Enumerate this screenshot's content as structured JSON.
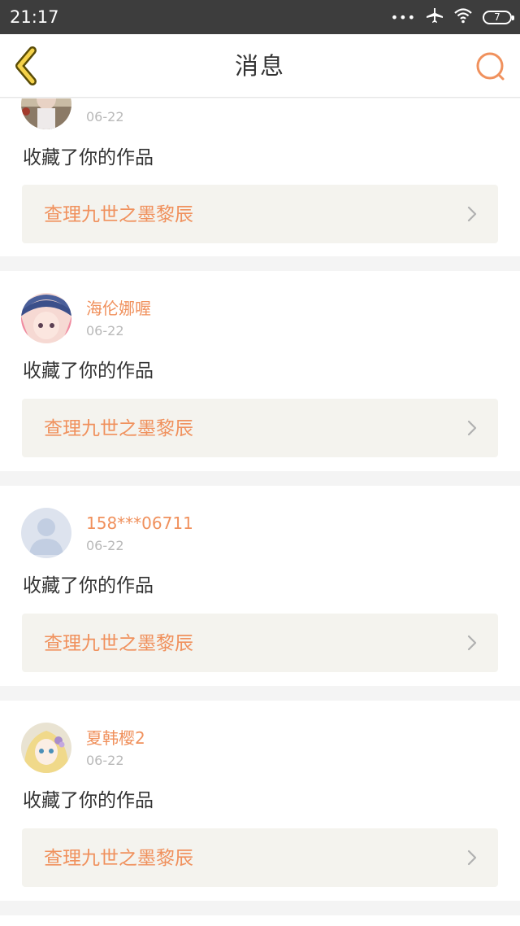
{
  "status_bar": {
    "time": "21:17",
    "dots": "•••",
    "battery": "7"
  },
  "header": {
    "title": "消息"
  },
  "colors": {
    "accent": "#f0915d",
    "back_arrow": "#7a6a08",
    "back_arrow_fill": "#f5d24a",
    "status_bar_bg": "#3d3d3d"
  },
  "icons": {
    "back": "back-arrow-icon",
    "search": "search-icon",
    "chevron": "chevron-right-icon"
  },
  "notifications": [
    {
      "username": "",
      "date": "06-22",
      "action": "收藏了你的作品",
      "work_title": "查理九世之墨黎辰"
    },
    {
      "username": "海伦娜喔",
      "date": "06-22",
      "action": "收藏了你的作品",
      "work_title": "查理九世之墨黎辰"
    },
    {
      "username": "158***06711",
      "date": "06-22",
      "action": "收藏了你的作品",
      "work_title": "查理九世之墨黎辰"
    },
    {
      "username": "夏韩樱2",
      "date": "06-22",
      "action": "收藏了你的作品",
      "work_title": "查理九世之墨黎辰"
    }
  ]
}
